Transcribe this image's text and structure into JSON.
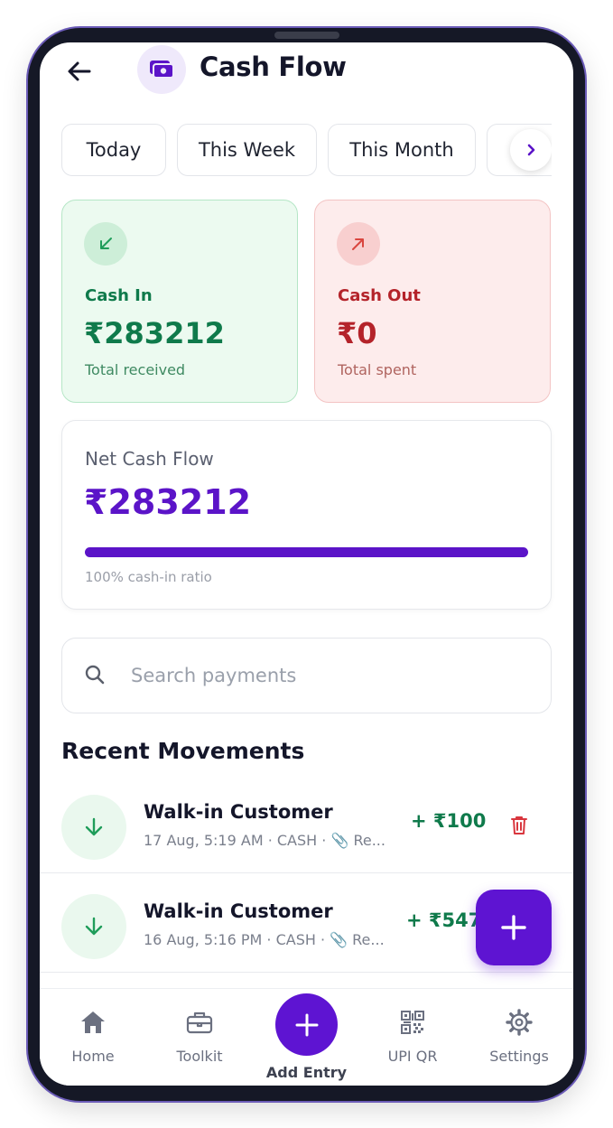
{
  "header": {
    "title": "Cash Flow",
    "back_icon": "arrow-left-icon",
    "logo_icon": "wallet-cash-icon"
  },
  "period_tabs": {
    "items": [
      "Today",
      "This Week",
      "This Month"
    ],
    "next_icon": "chevron-right-icon"
  },
  "cash_in": {
    "label": "Cash In",
    "amount": "₹283212",
    "sub": "Total received",
    "icon": "arrow-down-left-icon",
    "color": "#0f7a4b"
  },
  "cash_out": {
    "label": "Cash Out",
    "amount": "₹0",
    "sub": "Total spent",
    "icon": "arrow-up-right-icon",
    "color": "#b4232a"
  },
  "net": {
    "label": "Net Cash Flow",
    "amount": "₹283212",
    "ratio_fraction": 1.0,
    "ratio_text": "100% cash-in ratio",
    "color": "#5b14c8"
  },
  "search": {
    "placeholder": "Search payments",
    "value": ""
  },
  "recent": {
    "title": "Recent Movements",
    "rows": [
      {
        "name": "Walk-in Customer",
        "meta": "17 Aug, 5:19 AM · CASH · 📎 Re...",
        "amount": "+ ₹100"
      },
      {
        "name": "Walk-in Customer",
        "meta": "16 Aug, 5:16 PM · CASH · 📎 Re...",
        "amount": "+ ₹547"
      }
    ]
  },
  "fab": {
    "icon": "plus-icon"
  },
  "bottom_nav": {
    "home": "Home",
    "toolkit": "Toolkit",
    "add_entry": "Add Entry",
    "upi_qr": "UPI QR",
    "settings": "Settings"
  },
  "colors": {
    "accent": "#5e14d2",
    "positive": "#0f7a4b",
    "negative": "#b4232a"
  }
}
